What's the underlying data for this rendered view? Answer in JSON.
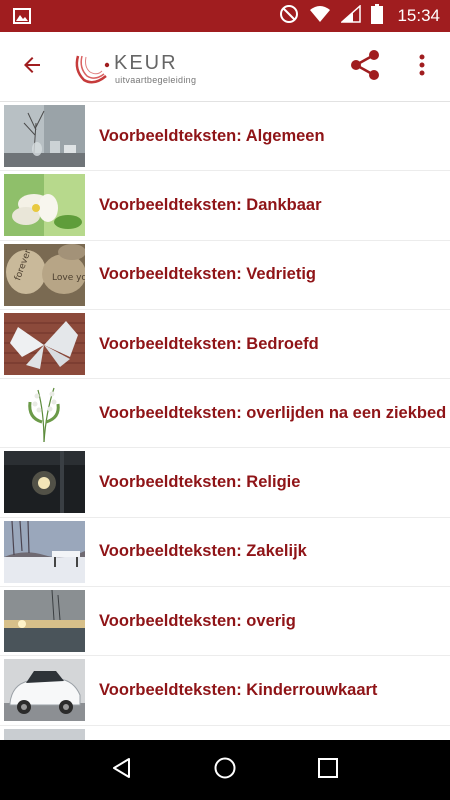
{
  "status_bar": {
    "time": "15:34",
    "icons": [
      "image-icon",
      "do-not-disturb-icon",
      "wifi-icon",
      "signal-icon",
      "battery-icon"
    ]
  },
  "toolbar": {
    "back_icon": "arrow-back-icon",
    "logo_text": "KEUR",
    "logo_subtext": "uitvaartbegeleiding",
    "share_icon": "share-icon",
    "menu_icon": "more-vert-icon"
  },
  "colors": {
    "primary": "#a01d1f",
    "label": "#8f1417"
  },
  "list": {
    "items": [
      {
        "label": "Voorbeeldteksten: Algemeen"
      },
      {
        "label": "Voorbeeldteksten: Dankbaar"
      },
      {
        "label": "Voorbeeldteksten: Vedrietig"
      },
      {
        "label": "Voorbeeldteksten: Bedroefd"
      },
      {
        "label": "Voorbeeldteksten: overlijden na een ziekbed"
      },
      {
        "label": "Voorbeeldteksten: Religie"
      },
      {
        "label": "Voorbeeldteksten: Zakelijk"
      },
      {
        "label": "Voorbeeldteksten: overig"
      },
      {
        "label": "Voorbeeldteksten: Kinderrouwkaart"
      }
    ]
  },
  "nav_bar": {
    "icons": [
      "nav-back-icon",
      "nav-home-icon",
      "nav-recents-icon"
    ]
  }
}
